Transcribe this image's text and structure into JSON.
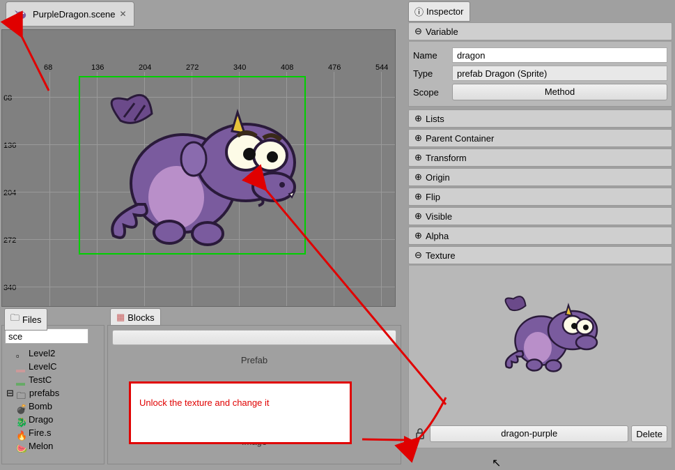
{
  "editor": {
    "tab_label": "PurpleDragon.scene",
    "ruler_x": [
      "68",
      "136",
      "204",
      "272",
      "340",
      "408",
      "476",
      "544"
    ],
    "ruler_y": [
      "68",
      "136",
      "204",
      "272",
      "340"
    ]
  },
  "files_panel": {
    "tab": "Files",
    "search_value": "sce",
    "items": [
      {
        "icon": "scene",
        "label": "Level2"
      },
      {
        "icon": "scene",
        "label": "LevelC"
      },
      {
        "icon": "scene",
        "label": "TestC"
      },
      {
        "icon": "folder",
        "label": "prefabs"
      },
      {
        "icon": "bomb",
        "label": "Bomb"
      },
      {
        "icon": "dragon",
        "label": "Drago"
      },
      {
        "icon": "fire",
        "label": "Fire.s"
      },
      {
        "icon": "melon",
        "label": "Melon"
      }
    ]
  },
  "blocks_panel": {
    "tab": "Blocks",
    "section1": "Prefab",
    "section2": "Image"
  },
  "inspector": {
    "tab": "Inspector",
    "variable_head": "Variable",
    "name_label": "Name",
    "name_value": "dragon",
    "type_label": "Type",
    "type_value": "prefab Dragon (Sprite)",
    "scope_label": "Scope",
    "scope_value": "Method",
    "groups": [
      "Lists",
      "Parent Container",
      "Transform",
      "Origin",
      "Flip",
      "Visible",
      "Alpha"
    ],
    "texture_head": "Texture",
    "texture_name": "dragon-purple",
    "delete": "Delete"
  },
  "annotation": "Unlock the texture and change it"
}
